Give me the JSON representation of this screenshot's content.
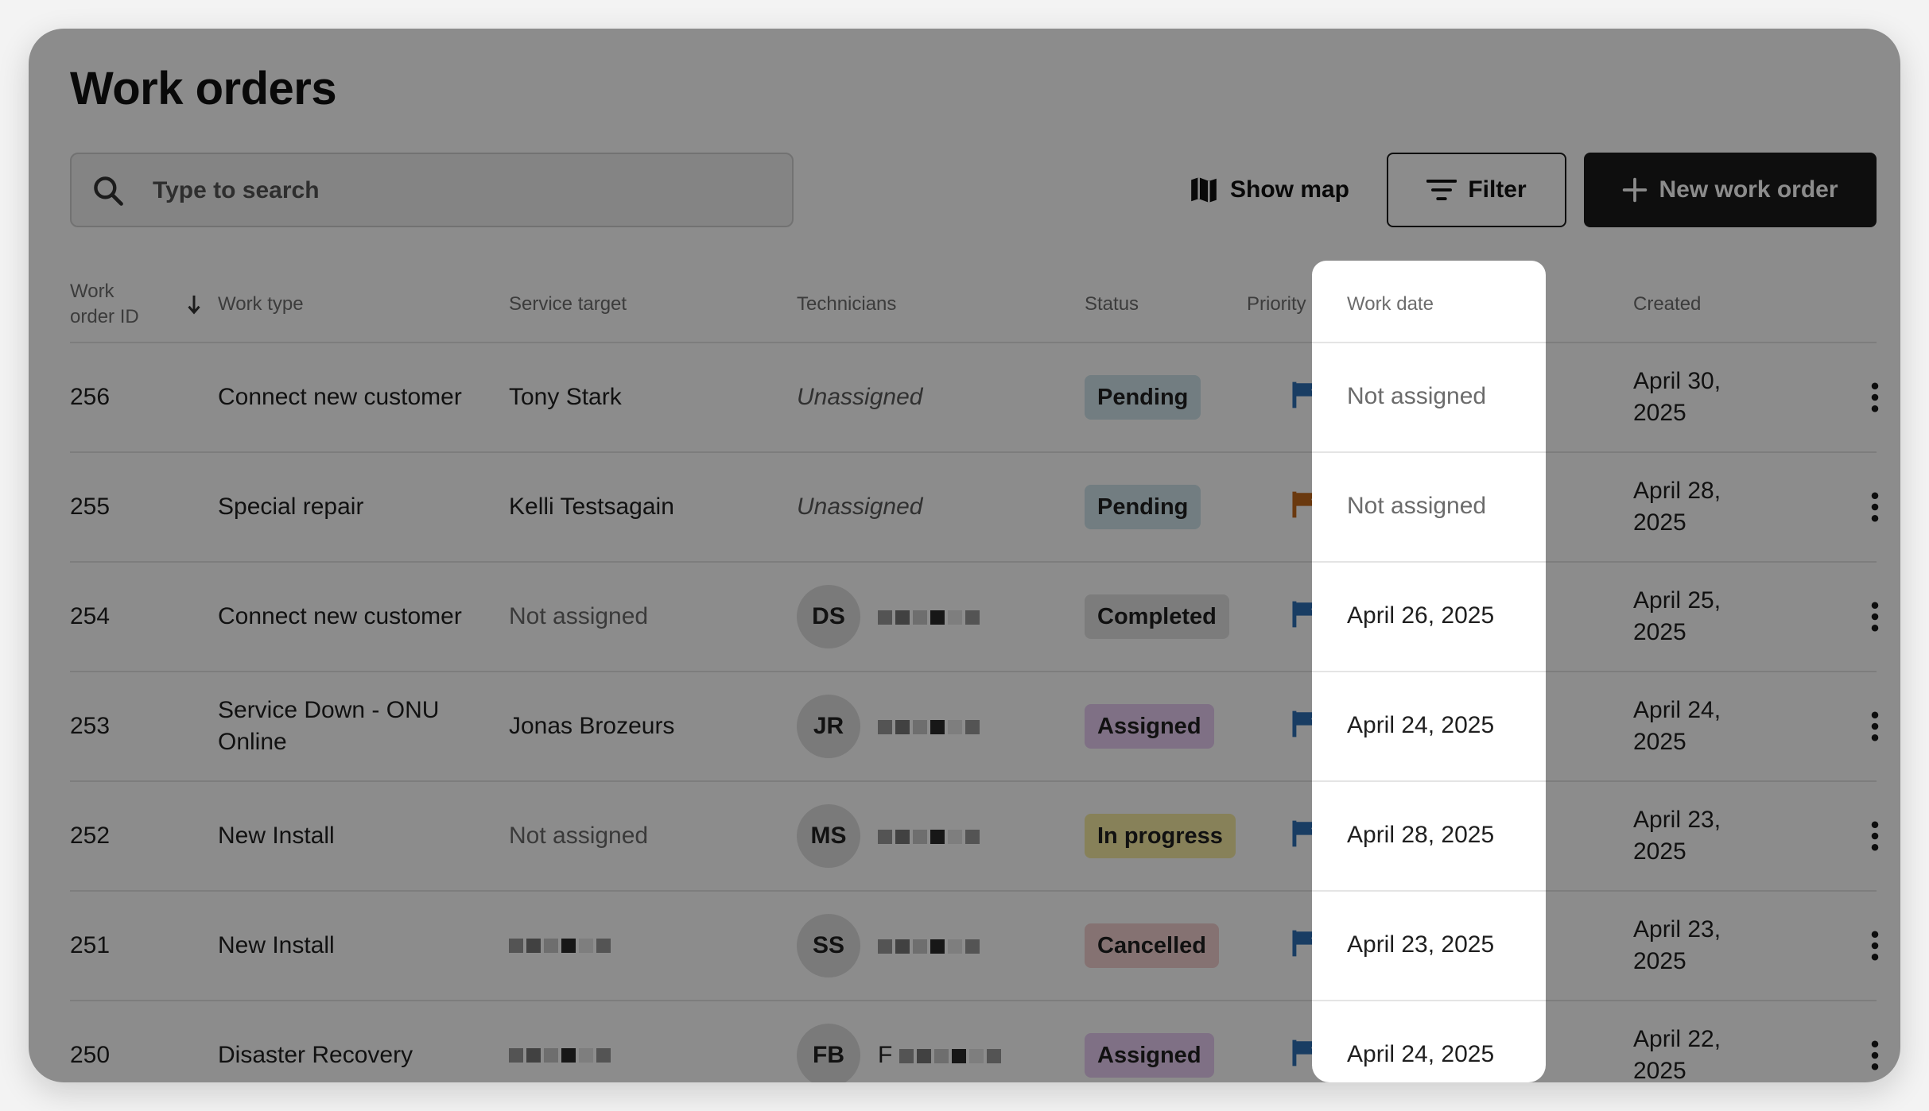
{
  "page_title": "Work orders",
  "search": {
    "placeholder": "Type to search"
  },
  "toolbar": {
    "show_map_label": "Show map",
    "filter_label": "Filter",
    "new_label": "New work order"
  },
  "columns": {
    "id": "Work order ID",
    "work_type": "Work type",
    "service_target": "Service target",
    "technicians": "Technicians",
    "status": "Status",
    "priority": "Priority",
    "work_date": "Work date",
    "created": "Created"
  },
  "colors": {
    "flag_blue": "#2f6fb4",
    "flag_orange": "#c2681c",
    "pending": "#cfe3ec",
    "completed": "#e2e2e2",
    "assigned": "#e8cdf3",
    "in_progress": "#f6eca2",
    "cancelled": "#f3d0d0"
  },
  "rows": [
    {
      "id": "256",
      "work_type": "Connect new customer",
      "service_target": "Tony Stark",
      "technician": "Unassigned",
      "initials": "",
      "status": "Pending",
      "status_key": "pending",
      "priority": "blue",
      "work_date": "Not assigned",
      "created": "April 30, 2025"
    },
    {
      "id": "255",
      "work_type": "Special repair",
      "service_target": "Kelli Testsagain",
      "technician": "Unassigned",
      "initials": "",
      "status": "Pending",
      "status_key": "pending",
      "priority": "orange",
      "work_date": "Not assigned",
      "created": "April 28, 2025"
    },
    {
      "id": "254",
      "work_type": "Connect new customer",
      "service_target": "Not assigned",
      "technician": "",
      "initials": "DS",
      "status": "Completed",
      "status_key": "completed",
      "priority": "blue",
      "work_date": "April 26, 2025",
      "created": "April 25, 2025"
    },
    {
      "id": "253",
      "work_type": "Service Down - ONU Online",
      "service_target": "Jonas Brozeurs",
      "technician": "",
      "initials": "JR",
      "status": "Assigned",
      "status_key": "assigned",
      "priority": "blue",
      "work_date": "April 24, 2025",
      "created": "April 24, 2025"
    },
    {
      "id": "252",
      "work_type": "New Install",
      "service_target": "Not assigned",
      "technician": "",
      "initials": "MS",
      "status": "In progress",
      "status_key": "in_progress",
      "priority": "blue",
      "work_date": "April 28, 2025",
      "created": "April 23, 2025"
    },
    {
      "id": "251",
      "work_type": "New Install",
      "service_target": "",
      "technician": "",
      "initials": "SS",
      "status": "Cancelled",
      "status_key": "cancelled",
      "priority": "blue",
      "work_date": "April 23, 2025",
      "created": "April 23, 2025"
    },
    {
      "id": "250",
      "work_type": "Disaster Recovery",
      "service_target": "",
      "technician": "F",
      "initials": "FB",
      "status": "Assigned",
      "status_key": "assigned",
      "priority": "blue",
      "work_date": "April 24, 2025",
      "created": "April 22, 2025"
    }
  ]
}
